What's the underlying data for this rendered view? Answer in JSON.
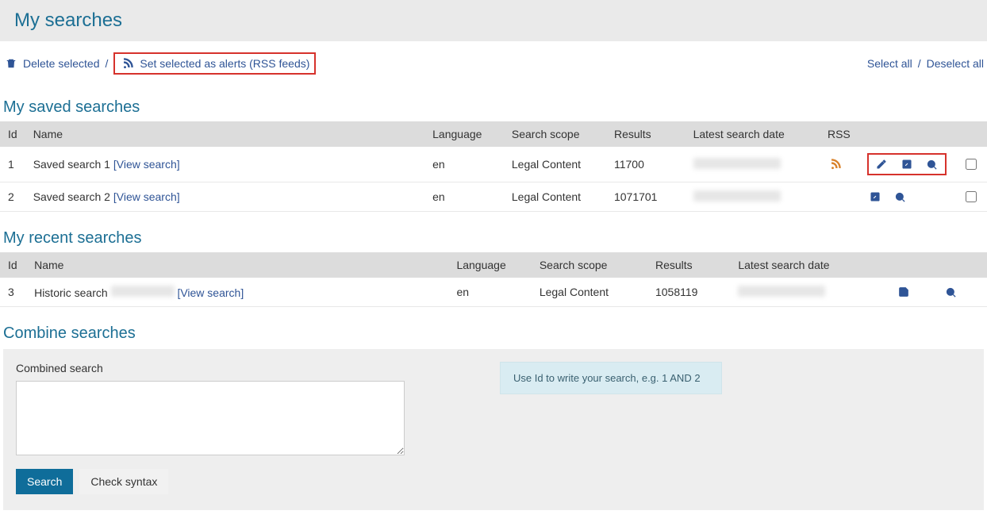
{
  "page": {
    "title": "My searches"
  },
  "toolbar": {
    "delete_selected": "Delete selected",
    "set_alerts": "Set selected as alerts (RSS feeds)",
    "select_all": "Select all",
    "deselect_all": "Deselect all"
  },
  "saved": {
    "heading": "My saved searches",
    "cols": {
      "id": "Id",
      "name": "Name",
      "language": "Language",
      "scope": "Search scope",
      "results": "Results",
      "date": "Latest search date",
      "rss": "RSS"
    },
    "rows": [
      {
        "id": "1",
        "name": "Saved search 1",
        "view": "[View search]",
        "language": "en",
        "scope": "Legal Content",
        "results": "11700",
        "has_rss": true,
        "boxed_actions": true,
        "has_edit": true
      },
      {
        "id": "2",
        "name": "Saved search 2",
        "view": "[View search]",
        "language": "en",
        "scope": "Legal Content",
        "results": "1071701",
        "has_rss": false,
        "boxed_actions": false,
        "has_edit": false
      }
    ]
  },
  "recent": {
    "heading": "My recent searches",
    "cols": {
      "id": "Id",
      "name": "Name",
      "language": "Language",
      "scope": "Search scope",
      "results": "Results",
      "date": "Latest search date"
    },
    "rows": [
      {
        "id": "3",
        "name": "Historic search",
        "view": "[View search]",
        "language": "en",
        "scope": "Legal Content",
        "results": "1058119"
      }
    ]
  },
  "combine": {
    "heading": "Combine searches",
    "label": "Combined search",
    "search_btn": "Search",
    "check_btn": "Check syntax",
    "hint": "Use Id to write your search, e.g. 1 AND 2"
  }
}
